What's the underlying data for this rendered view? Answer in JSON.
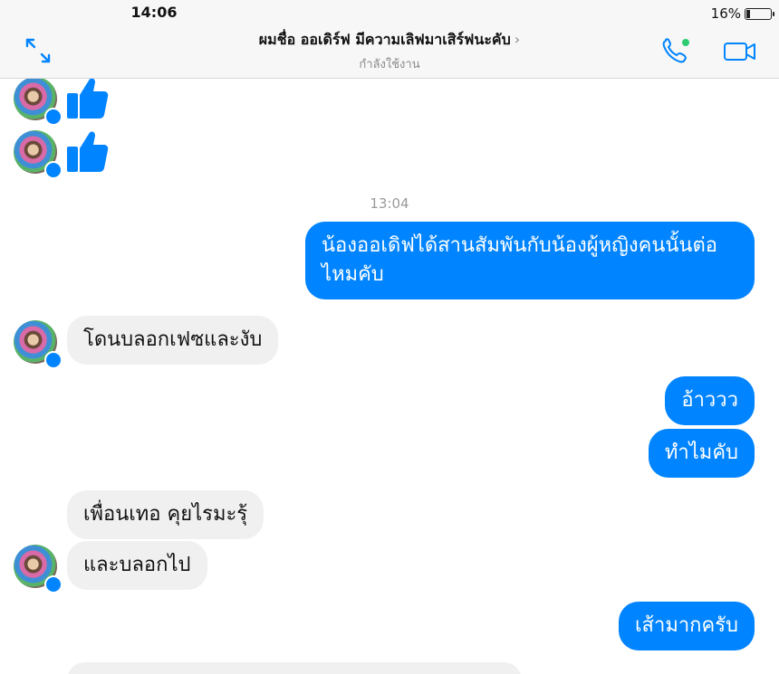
{
  "status_bar": {
    "time": "14:06",
    "battery_text": "16%",
    "battery_level": 0.16
  },
  "header": {
    "title": "ผมชื่อ ออเดิร์ฟ มีความเลิฟมาเสิร์ฟนะคับ",
    "chevron": "›",
    "subtitle": "กำลังใช้งาน",
    "icons": [
      "expand-icon",
      "phone-icon",
      "video-camera-icon"
    ],
    "active_dot_color": "#2ecc71"
  },
  "colors": {
    "accent": "#0084ff",
    "incoming_bubble": "#f1f0f0"
  },
  "messages": {
    "timestamp": "13:04",
    "out_1": "น้องออเดิฟได้สานสัมพันกับน้องผู้หญิงคนนั้นต่อ ไหมคับ",
    "in_1": "โดนบลอกเฟซและงับ",
    "out_2": "อ้าววว",
    "out_3": "ทำไมคับ",
    "in_2": "เพื่อนเทอ คุยไรมะรุ้",
    "in_3": "และบลอกไป",
    "out_4": "เส้ามากครับ"
  }
}
